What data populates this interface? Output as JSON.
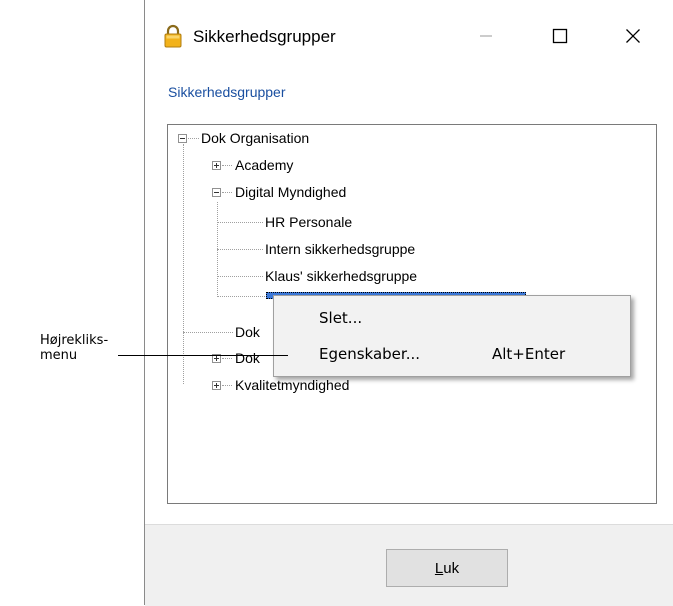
{
  "window": {
    "title": "Sikkerhedsgrupper",
    "header_label": "Sikkerhedsgrupper",
    "close_button_label": "Luk"
  },
  "tree": {
    "root": {
      "label": "Dok Organisation",
      "state": "expanded"
    },
    "level1": [
      {
        "label": "Academy",
        "state": "collapsed"
      },
      {
        "label": "Digital Myndighed",
        "state": "expanded"
      },
      {
        "label": "Dok",
        "state": "leaf"
      },
      {
        "label": "Dok",
        "state": "collapsed"
      },
      {
        "label": "Kvalitetmyndighed",
        "state": "collapsed"
      }
    ],
    "digital_children": [
      {
        "label": "HR Personale"
      },
      {
        "label": "Intern sikkerhedsgruppe"
      },
      {
        "label": "Klaus' sikkerhedsgruppe"
      }
    ]
  },
  "context_menu": {
    "items": [
      {
        "label": "Slet...",
        "shortcut": ""
      },
      {
        "label": "Egenskaber...",
        "shortcut": "Alt+Enter"
      }
    ]
  },
  "annotation": {
    "line1": "Højrekliks-",
    "line2": "menu"
  },
  "icons": {
    "title_icon": "padlock-icon",
    "minimize": "minimize-icon",
    "maximize": "maximize-icon",
    "close": "close-icon"
  },
  "colors": {
    "link_blue": "#1a4fa0",
    "selection_blue": "#3c78d8",
    "menu_bg": "#f2f2f2",
    "footer_bg": "#f0f0f0"
  }
}
